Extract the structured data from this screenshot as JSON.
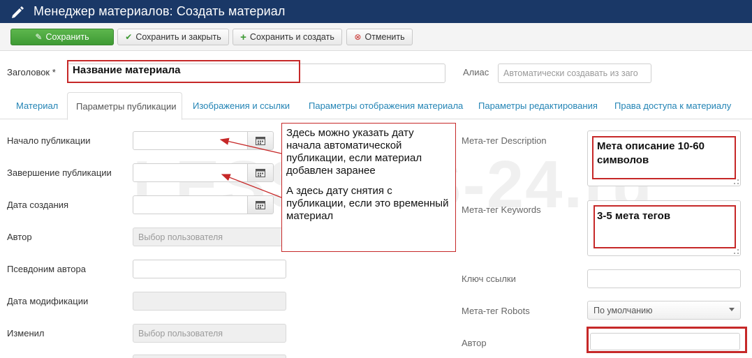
{
  "header": {
    "title": "Менеджер материалов: Создать материал"
  },
  "toolbar": {
    "save": "Сохранить",
    "save_close": "Сохранить и закрыть",
    "save_new": "Сохранить и создать",
    "cancel": "Отменить"
  },
  "title_field": {
    "label": "Заголовок *",
    "value": "Название материала"
  },
  "alias_field": {
    "label": "Алиас",
    "placeholder": "Автоматически создавать из заго"
  },
  "tabs": {
    "material": "Материал",
    "publishing": "Параметры публикации",
    "images": "Изображения и ссылки",
    "display": "Параметры отображения материала",
    "editing": "Параметры редактирования",
    "permissions": "Права доступа к материалу"
  },
  "left_fields": {
    "publish_up": "Начало публикации",
    "publish_down": "Завершение публикации",
    "created": "Дата создания",
    "author": "Автор",
    "author_placeholder": "Выбор пользователя",
    "author_alias": "Псевдоним автора",
    "modified": "Дата модификации",
    "modified_by": "Изменил",
    "modified_by_placeholder": "Выбор пользователя"
  },
  "annotation": {
    "line1": "Здесь можно указать дату начала автоматической публикации, если материал добавлен заранее",
    "line2": "А здесь дату снятия с публикации, если это временный материал"
  },
  "right_fields": {
    "meta_description": "Мета-тег Description",
    "meta_description_value": "Мета описание 10-60 символов",
    "meta_keywords": "Мета-тег Keywords",
    "meta_keywords_value": "3-5 мета тегов",
    "link_key": "Ключ ссылки",
    "meta_robots": "Мета-тег Robots",
    "meta_robots_value": "По умолчанию",
    "author": "Автор"
  },
  "watermark": "LESSONS-24.ru",
  "colors": {
    "header_bg": "#1a3867",
    "save_green": "#3e9a34",
    "annotation_red": "#c62828",
    "tab_link": "#2384b5"
  }
}
